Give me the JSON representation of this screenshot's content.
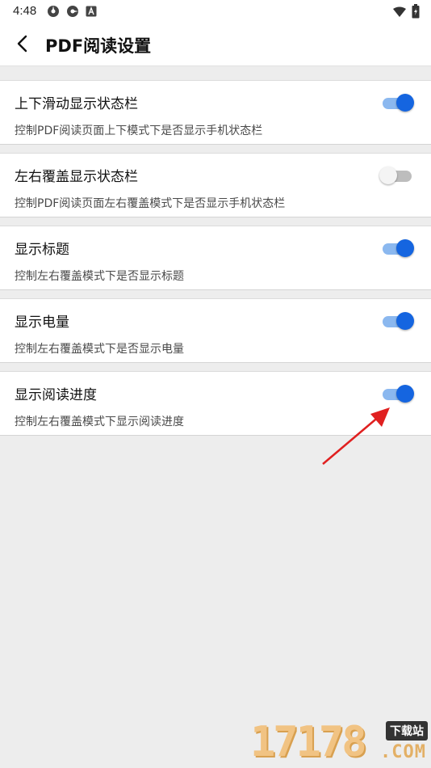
{
  "status_bar": {
    "time": "4:48",
    "left_icons": [
      "gear-like-icon",
      "gear-like-icon",
      "a-notification-icon"
    ],
    "right_icons": [
      "wifi-icon",
      "battery-icon"
    ]
  },
  "header": {
    "title": "PDF阅读设置",
    "back_icon": "chevron-left-icon"
  },
  "settings": [
    {
      "title": "上下滑动显示状态栏",
      "description": "控制PDF阅读页面上下模式下是否显示手机状态栏",
      "enabled": true
    },
    {
      "title": "左右覆盖显示状态栏",
      "description": "控制PDF阅读页面左右覆盖模式下是否显示手机状态栏",
      "enabled": false
    },
    {
      "title": "显示标题",
      "description": "控制左右覆盖模式下是否显示标题",
      "enabled": true
    },
    {
      "title": "显示电量",
      "description": "控制左右覆盖模式下是否显示电量",
      "enabled": true
    },
    {
      "title": "显示阅读进度",
      "description": "控制左右覆盖模式下显示阅读进度",
      "enabled": true
    }
  ],
  "colors": {
    "toggle_on_thumb": "#1565e0",
    "toggle_on_track": "#8bb8ef",
    "toggle_off_track": "#bdbdbd",
    "annotation_arrow": "#e02020"
  },
  "watermark": {
    "digits": "17178",
    "tag": "下载站",
    "suffix": ".COM"
  }
}
